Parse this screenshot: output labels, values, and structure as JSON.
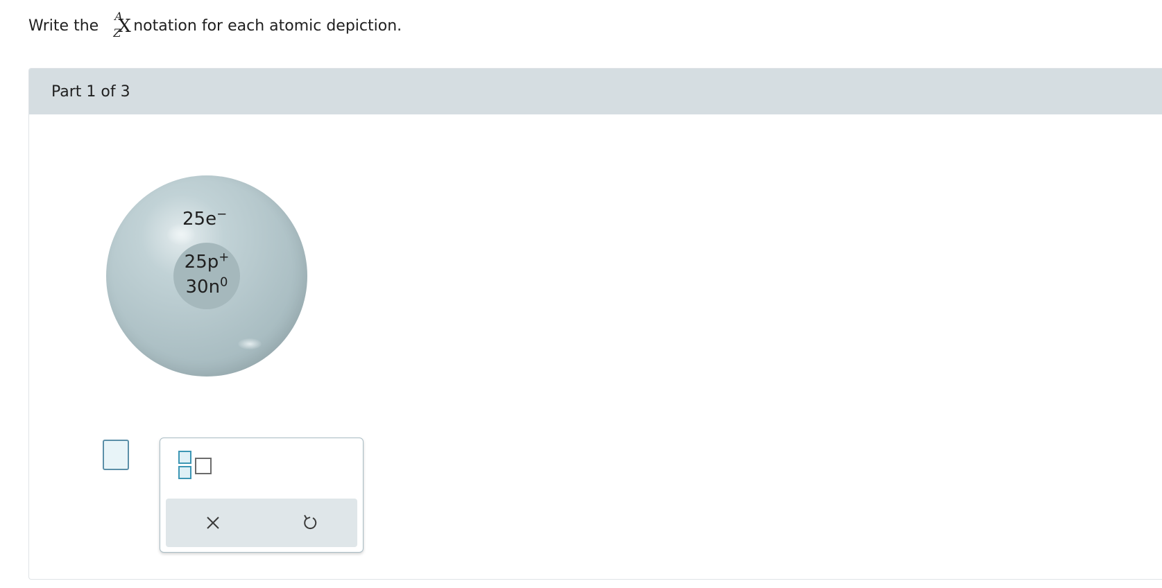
{
  "prompt": {
    "before": "Write the",
    "notation_superscript": "A",
    "notation_subscript": "Z",
    "notation_symbol": "X",
    "after": "notation for each atomic depiction."
  },
  "part": {
    "label": "Part 1 of 3"
  },
  "atom": {
    "electrons_count": "25e",
    "electrons_charge": "−",
    "protons_count": "25p",
    "protons_charge": "+",
    "neutrons_count": "30n",
    "neutrons_charge": "0"
  },
  "palette": {
    "template_icon": "superscript-subscript-template-icon",
    "clear_icon": "close-icon",
    "undo_icon": "undo-icon"
  },
  "colors": {
    "header_bg": "#d5dde1",
    "accent": "#3c96b4",
    "action_bar_bg": "#dfe6e9"
  }
}
